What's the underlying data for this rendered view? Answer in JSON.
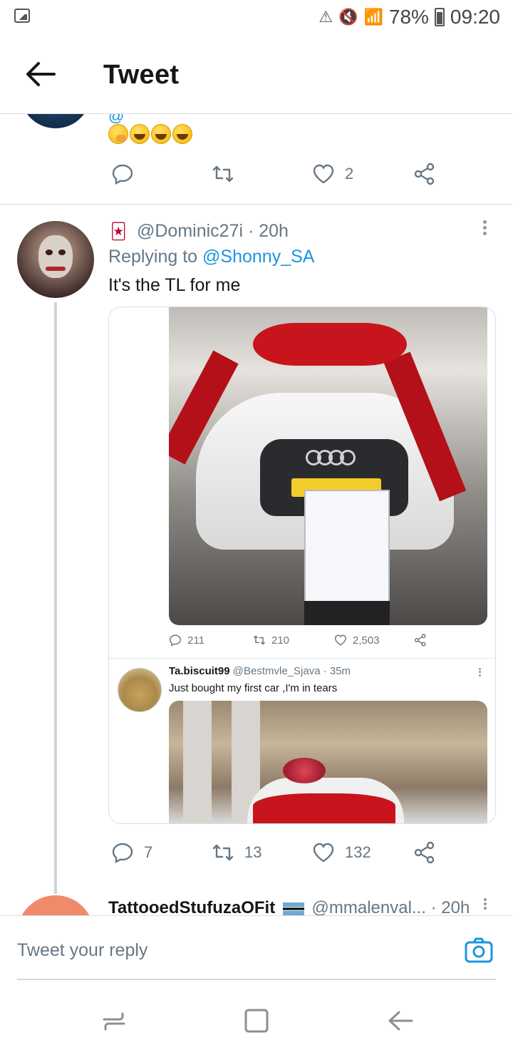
{
  "status_bar": {
    "battery": "78%",
    "time": "09:20"
  },
  "header": {
    "title": "Tweet"
  },
  "previous_tweet": {
    "handle_fragment": "@",
    "like_count": "2"
  },
  "main_tweet": {
    "handle_time": "@Dominic27i · 20h",
    "replying_prefix": "Replying to ",
    "replying_to": "@Shonny_SA",
    "text": "It's the TL for me",
    "card": {
      "stats": {
        "replies": "211",
        "retweets": "210",
        "likes": "2,503"
      },
      "inner_tweet": {
        "name": "Ta.biscuit99",
        "meta": "@Bestmvle_Sjava · 35m",
        "text": "Just bought my first car ,I'm in tears"
      }
    },
    "actions": {
      "replies": "7",
      "retweets": "13",
      "likes": "132"
    }
  },
  "next_tweet": {
    "name": "TattooedStufuzaOFit",
    "meta": "@mmalenval... · 20h"
  },
  "reply_bar": {
    "placeholder": "Tweet your reply"
  },
  "colors": {
    "accent": "#1b95e0",
    "muted": "#657786",
    "divider": "#d9dee2"
  }
}
